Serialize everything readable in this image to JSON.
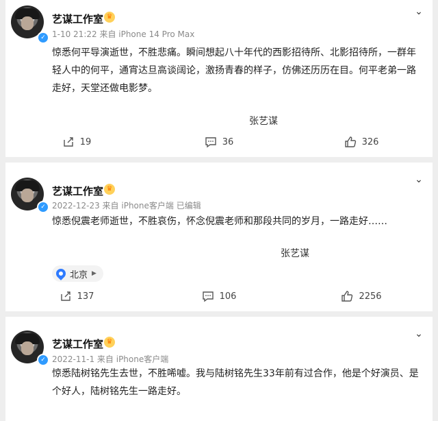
{
  "posts": [
    {
      "author": "艺谋工作室",
      "meta": "1-10 21:22  来自 iPhone 14 Pro Max",
      "text": "惊悉何平导演逝世，不胜悲痛。瞬间想起八十年代的西影招待所、北影招待所，一群年轻人中的何平，通宵达旦高谈阔论，激扬青春的样子，仿佛还历历在目。何平老弟一路走好，天堂还做电影梦。",
      "signature": "张艺谋",
      "reposts": "19",
      "comments": "36",
      "likes": "326"
    },
    {
      "author": "艺谋工作室",
      "meta": "2022-12-23  来自 iPhone客户端 已编辑",
      "text": "惊悉倪震老师逝世，不胜哀伤，怀念倪震老师和那段共同的岁月，一路走好……",
      "signature": "张艺谋",
      "location": "北京",
      "reposts": "137",
      "comments": "106",
      "likes": "2256"
    },
    {
      "author": "艺谋工作室",
      "meta": "2022-11-1  来自 iPhone客户端",
      "text": "惊悉陆树铭先生去世，不胜唏嘘。我与陆树铭先生33年前有过合作，他是个好演员、是个好人，陆树铭先生一路走好。"
    }
  ],
  "colors": {
    "background": "#eeeeee",
    "verified_badge": "#2f9bff",
    "crown": "#ffd15a"
  },
  "icons": [
    "repost-icon",
    "comment-icon",
    "like-icon",
    "location-pin-icon",
    "chevron-down-icon",
    "crown-icon",
    "verified-icon"
  ]
}
